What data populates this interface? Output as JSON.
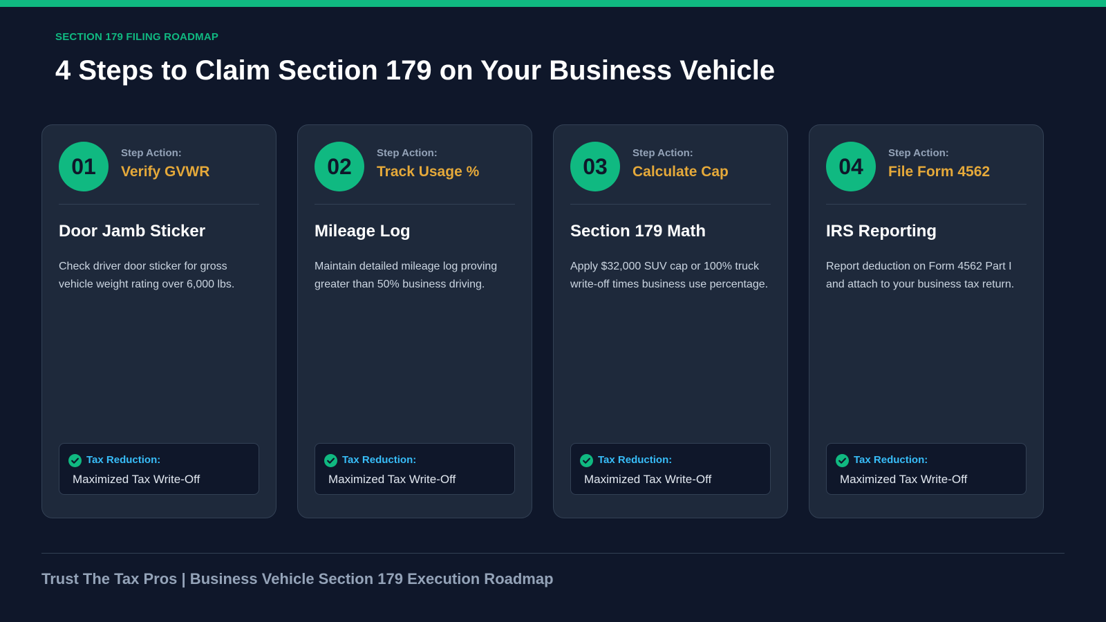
{
  "header": {
    "eyebrow": "SECTION 179 FILING ROADMAP",
    "title": "4 Steps to Claim Section 179 on Your Business Vehicle"
  },
  "colors": {
    "accent": "#10b981",
    "background": "#0f172a",
    "card": "#1e293b",
    "action_value": "#e5a93a",
    "reduction_label": "#38bdf8"
  },
  "steps": [
    {
      "number": "01",
      "action_label": "Step Action:",
      "action_value": "Verify GVWR",
      "title": "Door Jamb Sticker",
      "description": "Check driver door sticker for gross vehicle weight rating over 6,000 lbs.",
      "reduction_label": "Tax Reduction:",
      "reduction_value": "Maximized Tax Write-Off",
      "icon": "check-circle-icon"
    },
    {
      "number": "02",
      "action_label": "Step Action:",
      "action_value": "Track Usage %",
      "title": "Mileage Log",
      "description": "Maintain detailed mileage log proving greater than 50% business driving.",
      "reduction_label": "Tax Reduction:",
      "reduction_value": "Maximized Tax Write-Off",
      "icon": "check-circle-icon"
    },
    {
      "number": "03",
      "action_label": "Step Action:",
      "action_value": "Calculate Cap",
      "title": "Section 179 Math",
      "description": "Apply $32,000 SUV cap or 100% truck write-off times business use percentage.",
      "reduction_label": "Tax Reduction:",
      "reduction_value": "Maximized Tax Write-Off",
      "icon": "check-circle-icon"
    },
    {
      "number": "04",
      "action_label": "Step Action:",
      "action_value": "File Form 4562",
      "title": "IRS Reporting",
      "description": "Report deduction on Form 4562 Part I and attach to your business tax return.",
      "reduction_label": "Tax Reduction:",
      "reduction_value": "Maximized Tax Write-Off",
      "icon": "check-circle-icon"
    }
  ],
  "footer": {
    "text": "Trust The Tax Pros | Business Vehicle Section 179 Execution Roadmap"
  }
}
